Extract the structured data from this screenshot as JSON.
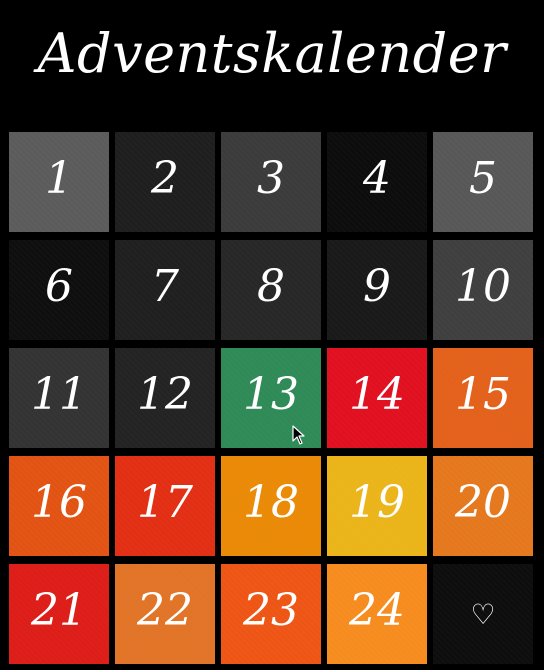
{
  "title": "Adventskalender",
  "tiles": [
    {
      "label": "1",
      "color": "#5b5b5b"
    },
    {
      "label": "2",
      "color": "#1e1e1e"
    },
    {
      "label": "3",
      "color": "#3b3b3b"
    },
    {
      "label": "4",
      "color": "#0c0c0c"
    },
    {
      "label": "5",
      "color": "#575757"
    },
    {
      "label": "6",
      "color": "#0e0e0e"
    },
    {
      "label": "7",
      "color": "#1f1f1f"
    },
    {
      "label": "8",
      "color": "#272727"
    },
    {
      "label": "9",
      "color": "#191919"
    },
    {
      "label": "10",
      "color": "#3f3f3f"
    },
    {
      "label": "11",
      "color": "#333333"
    },
    {
      "label": "12",
      "color": "#232323"
    },
    {
      "label": "13",
      "color": "#2e8a56"
    },
    {
      "label": "14",
      "color": "#e11021"
    },
    {
      "label": "15",
      "color": "#e3611b"
    },
    {
      "label": "16",
      "color": "#e25313"
    },
    {
      "label": "17",
      "color": "#e22f13"
    },
    {
      "label": "18",
      "color": "#ea8a06"
    },
    {
      "label": "19",
      "color": "#ebb419"
    },
    {
      "label": "20",
      "color": "#e5781d"
    },
    {
      "label": "21",
      "color": "#dd1d18"
    },
    {
      "label": "22",
      "color": "#e17427"
    },
    {
      "label": "23",
      "color": "#ee5515"
    },
    {
      "label": "24",
      "color": "#f68c1f"
    },
    {
      "label": "♡",
      "color": "#0d0d0d",
      "icon": "heart-icon"
    }
  ]
}
